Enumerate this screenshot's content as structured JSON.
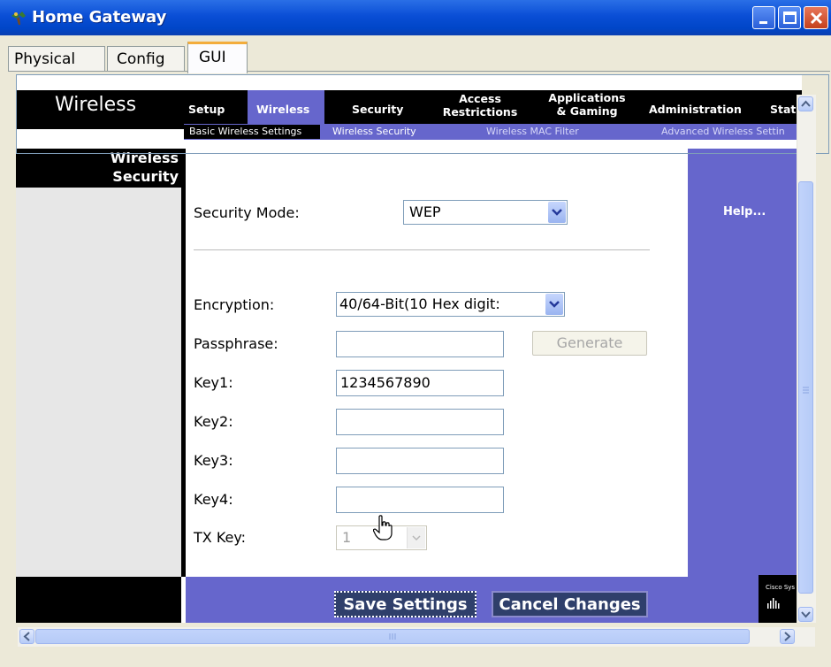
{
  "window": {
    "title": "Home Gateway"
  },
  "tabs": [
    {
      "label": "Physical"
    },
    {
      "label": "Config"
    },
    {
      "label": "GUI",
      "active": true
    }
  ],
  "router": {
    "page_label": "Wireless",
    "nav": [
      {
        "label": "Setup"
      },
      {
        "label": "Wireless",
        "active": true
      },
      {
        "label": "Security"
      },
      {
        "label_line1": "Access",
        "label_line2": "Restrictions"
      },
      {
        "label_line1": "Applications",
        "label_line2": "& Gaming"
      },
      {
        "label": "Administration"
      },
      {
        "label": "Stat"
      }
    ],
    "subnav": [
      {
        "label": "Basic Wireless Settings",
        "active": true
      },
      {
        "label": "Wireless Security"
      },
      {
        "label": "Wireless MAC Filter"
      },
      {
        "label": "Advanced Wireless Settin"
      }
    ],
    "section_title_line1": "Wireless",
    "section_title_line2": "Security",
    "help_link": "Help...",
    "logo_text": "Cisco Sys"
  },
  "form": {
    "security_mode_label": "Security Mode:",
    "security_mode_value": "WEP",
    "encryption_label": "Encryption:",
    "encryption_value": "40/64-Bit(10 Hex digit:",
    "passphrase_label": "Passphrase:",
    "passphrase_value": "",
    "generate_label": "Generate",
    "key1_label": "Key1:",
    "key1_value": "1234567890",
    "key2_label": "Key2:",
    "key2_value": "",
    "key3_label": "Key3:",
    "key3_value": "",
    "key4_label": "Key4:",
    "key4_value": "",
    "txkey_label": "TX Key:",
    "txkey_value": "1"
  },
  "buttons": {
    "save_label": "Save Settings",
    "cancel_label": "Cancel Changes"
  },
  "colors": {
    "router_purple": "#6666CC",
    "router_black": "#000000",
    "xp_blue": "#0A4ED6",
    "tab_orange": "#F3AD3C"
  }
}
